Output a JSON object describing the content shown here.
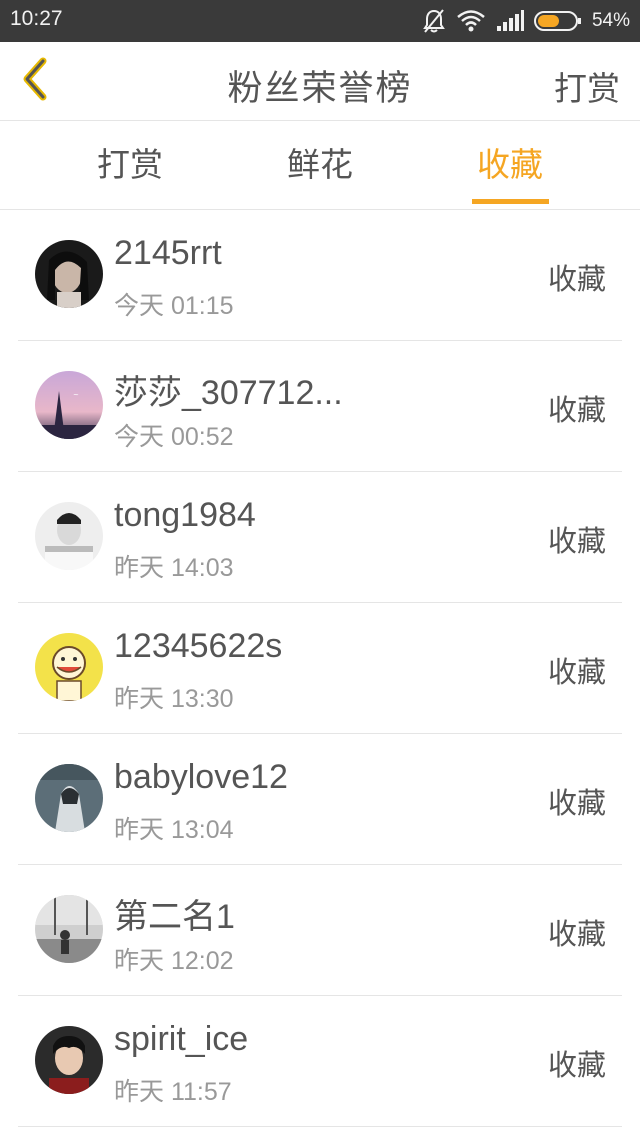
{
  "status_bar": {
    "time": "10:27",
    "battery_percent": "54%",
    "icons": [
      "bell-off-icon",
      "wifi-icon",
      "signal-icon",
      "battery-icon"
    ]
  },
  "header": {
    "title": "粉丝荣誉榜",
    "action_label": "打赏",
    "back_icon": "chevron-left-icon",
    "accent_color": "#f5a623"
  },
  "tabs": [
    {
      "label": "打赏",
      "active": false
    },
    {
      "label": "鲜花",
      "active": false
    },
    {
      "label": "收藏",
      "active": true
    }
  ],
  "list": [
    {
      "username": "2145rrt",
      "time": "今天 01:15",
      "action": "收藏"
    },
    {
      "username": "莎莎_307712...",
      "time": "今天 00:52",
      "action": "收藏"
    },
    {
      "username": "tong1984",
      "time": "昨天 14:03",
      "action": "收藏"
    },
    {
      "username": "12345622s",
      "time": "昨天 13:30",
      "action": "收藏"
    },
    {
      "username": "babylove12",
      "time": "昨天 13:04",
      "action": "收藏"
    },
    {
      "username": "第二名1",
      "time": "昨天 12:02",
      "action": "收藏"
    },
    {
      "username": "spirit_ice",
      "time": "昨天 11:57",
      "action": "收藏"
    }
  ]
}
